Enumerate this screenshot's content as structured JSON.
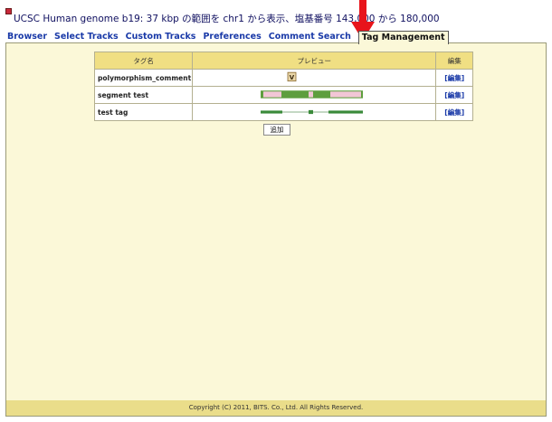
{
  "header": {
    "title": "UCSC Human genome b19: 37 kbp の範囲を chr1 から表示、塩基番号 143,000 から 180,000"
  },
  "tabs": [
    {
      "label": "Browser"
    },
    {
      "label": "Select Tracks"
    },
    {
      "label": "Custom Tracks"
    },
    {
      "label": "Preferences"
    },
    {
      "label": "Comment Search"
    },
    {
      "label": "Tag Management",
      "active": true
    }
  ],
  "table": {
    "headers": [
      "タグ名",
      "プレビュー",
      "編集"
    ],
    "rows": [
      {
        "name": "polymorphism_comment",
        "preview_glyph": "V",
        "edit": "[編集]"
      },
      {
        "name": "segment test",
        "edit": "[編集]"
      },
      {
        "name": "test tag",
        "edit": "[編集]"
      }
    ]
  },
  "add_button": "追加",
  "footer": "Copyright (C) 2011, BITS. Co., Ltd. All Rights Reserved.",
  "colors": {
    "panel_bg": "#fbf8d8",
    "header_bg": "#f0df83",
    "footer_bg": "#eadd8a",
    "link": "#1a3aa8",
    "arrow": "#e8141b",
    "track_green": "#3a8a3a",
    "track_pink": "#f2c6d6"
  }
}
